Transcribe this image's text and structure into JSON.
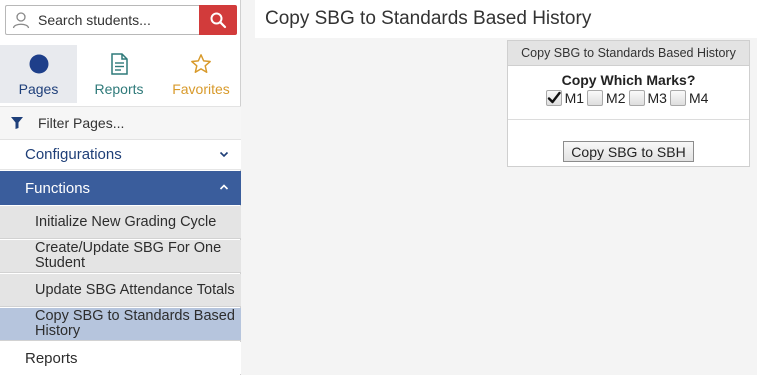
{
  "search": {
    "placeholder": "Search students..."
  },
  "tabs": [
    {
      "label": "Pages",
      "icon": "circle-icon"
    },
    {
      "label": "Reports",
      "icon": "document-icon"
    },
    {
      "label": "Favorites",
      "icon": "star-icon"
    }
  ],
  "filter": {
    "label": "Filter Pages..."
  },
  "nav": {
    "configurations": "Configurations",
    "functions": "Functions",
    "sub_items": [
      "Initialize New Grading Cycle",
      "Create/Update SBG For One Student",
      "Update SBG Attendance Totals",
      "Copy SBG to Standards Based History"
    ],
    "reports": "Reports"
  },
  "header": {
    "title": "Copy SBG to Standards Based History"
  },
  "panel": {
    "title": "Copy SBG to Standards Based History",
    "question": "Copy Which Marks?",
    "marks": [
      {
        "label": "M1",
        "checked": true
      },
      {
        "label": "M2",
        "checked": false
      },
      {
        "label": "M3",
        "checked": false
      },
      {
        "label": "M4",
        "checked": false
      }
    ],
    "button_label": "Copy SBG to SBH"
  },
  "colors": {
    "accent": "#3a5d9c",
    "search_button": "#d23b3b",
    "selected_subitem": "#b6c5dd",
    "reports_tab": "#2f7a7a",
    "favorites_tab": "#d89a2b"
  }
}
